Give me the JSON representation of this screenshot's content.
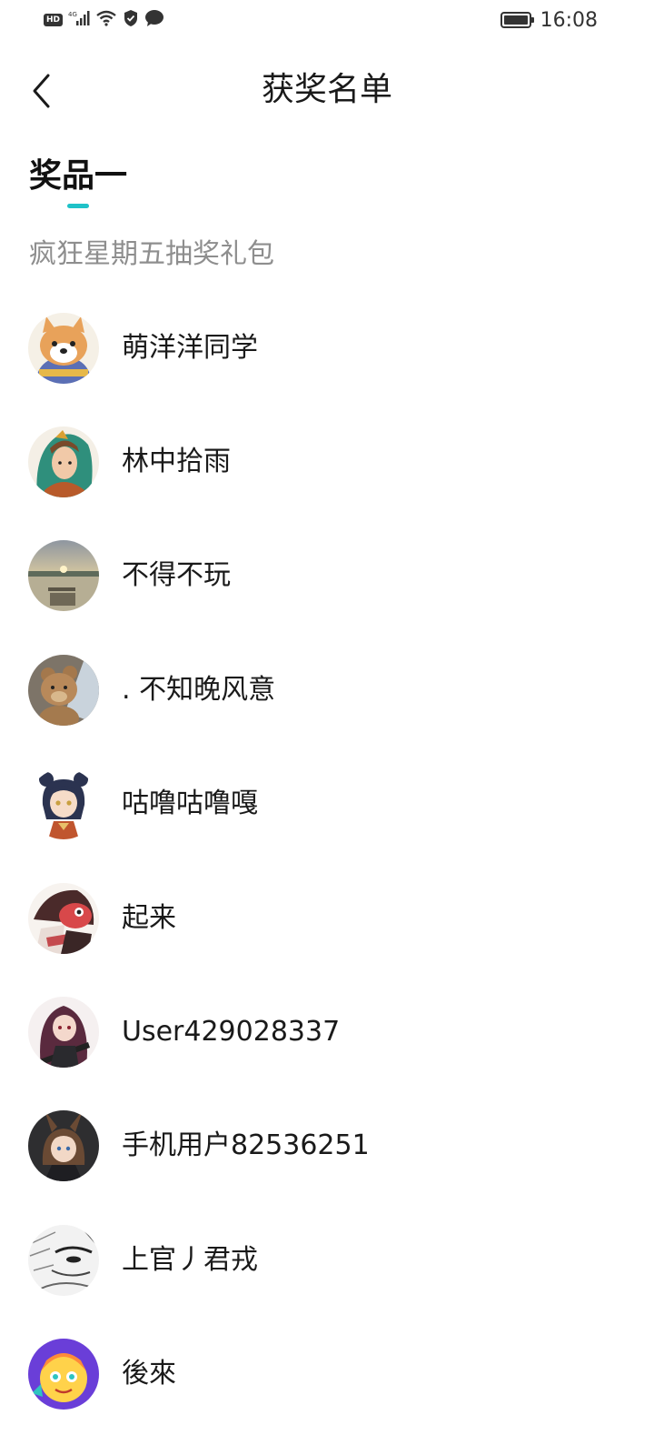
{
  "status_bar": {
    "network": "4G",
    "hd": "HD",
    "time": "16:08",
    "battery_level": 1.0
  },
  "header": {
    "title": "获奖名单",
    "back_icon": "chevron-left-icon"
  },
  "prize": {
    "tab_label": "奖品一",
    "description": "疯狂星期五抽奖礼包",
    "accent_color": "#1fc2c8"
  },
  "winners": [
    {
      "name": "萌洋洋同学",
      "avatar": "shiba-dog-avatar"
    },
    {
      "name": "林中拾雨",
      "avatar": "fantasy-warrior-avatar"
    },
    {
      "name": "不得不玩",
      "avatar": "lake-sunset-avatar"
    },
    {
      "name": ". 不知晚风意",
      "avatar": "teddy-bear-avatar"
    },
    {
      "name": "咕噜咕噜嘎",
      "avatar": "anime-girl-avatar"
    },
    {
      "name": "起来",
      "avatar": "red-fish-hat-avatar"
    },
    {
      "name": "User429028337",
      "avatar": "anime-gunner-avatar"
    },
    {
      "name": "手机用户82536251",
      "avatar": "bunny-ears-girl-avatar"
    },
    {
      "name": "上官丿君戎",
      "avatar": "sketch-face-avatar"
    },
    {
      "name": "後來",
      "avatar": "purple-cartoon-avatar"
    }
  ]
}
